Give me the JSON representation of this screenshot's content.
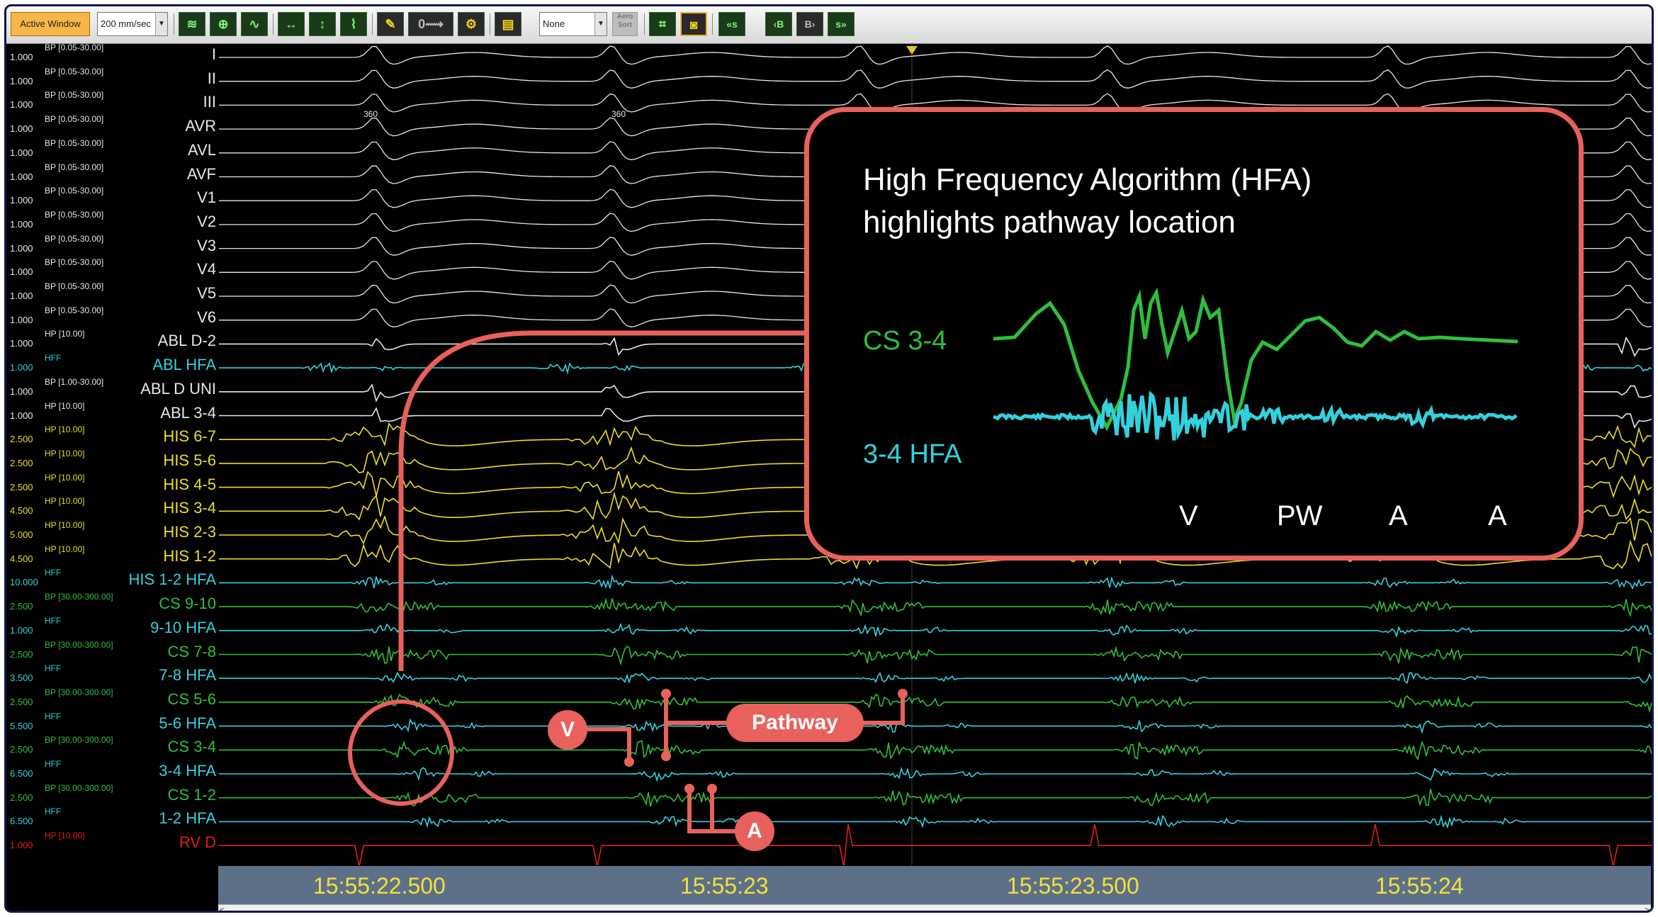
{
  "toolbar": {
    "active_window_label": "Active Window",
    "sweep_speed": "200 mm/sec",
    "reference": "None",
    "aero_label": "Aero Sort",
    "nav_prev_s": "«s",
    "nav_prev_b": "‹B",
    "nav_next_b": "B›",
    "nav_next_s": "s»"
  },
  "colors": {
    "ecg": "#e6e6e6",
    "abl": "#e6e6e6",
    "hfa_cyan": "#33d1de",
    "his_yellow": "#ecdc2a",
    "cs_green": "#2fbf3d",
    "rv_red": "#e0201c",
    "callout": "#e8615c",
    "time_text": "#f2e23a"
  },
  "channels": [
    {
      "gain": "1.000",
      "filter": "BP [0.05-30.00]",
      "name": "I",
      "color": "#e6e6e6"
    },
    {
      "gain": "1.000",
      "filter": "BP [0.05-30.00]",
      "name": "II",
      "color": "#e6e6e6"
    },
    {
      "gain": "1.000",
      "filter": "BP [0.05-30.00]",
      "name": "III",
      "color": "#e6e6e6"
    },
    {
      "gain": "1.000",
      "filter": "BP [0.05-30.00]",
      "name": "AVR",
      "color": "#e6e6e6"
    },
    {
      "gain": "1.000",
      "filter": "BP [0.05-30.00]",
      "name": "AVL",
      "color": "#e6e6e6"
    },
    {
      "gain": "1.000",
      "filter": "BP [0.05-30.00]",
      "name": "AVF",
      "color": "#e6e6e6"
    },
    {
      "gain": "1.000",
      "filter": "BP [0.05-30.00]",
      "name": "V1",
      "color": "#e6e6e6"
    },
    {
      "gain": "1.000",
      "filter": "BP [0.05-30.00]",
      "name": "V2",
      "color": "#e6e6e6"
    },
    {
      "gain": "1.000",
      "filter": "BP [0.05-30.00]",
      "name": "V3",
      "color": "#e6e6e6"
    },
    {
      "gain": "1.000",
      "filter": "BP [0.05-30.00]",
      "name": "V4",
      "color": "#e6e6e6"
    },
    {
      "gain": "1.000",
      "filter": "BP [0.05-30.00]",
      "name": "V5",
      "color": "#e6e6e6"
    },
    {
      "gain": "1.000",
      "filter": "BP [0.05-30.00]",
      "name": "V6",
      "color": "#e6e6e6"
    },
    {
      "gain": "1.000",
      "filter": "HP [10.00]",
      "name": "ABL D-2",
      "color": "#e6e6e6"
    },
    {
      "gain": "1.000",
      "filter": "HFF",
      "name": "ABL HFA",
      "color": "#33d1de"
    },
    {
      "gain": "1.000",
      "filter": "BP [1.00-30.00]",
      "name": "ABL D UNI",
      "color": "#e6e6e6"
    },
    {
      "gain": "1.000",
      "filter": "HP [10.00]",
      "name": "ABL 3-4",
      "color": "#e6e6e6"
    },
    {
      "gain": "2.500",
      "filter": "HP [10.00]",
      "name": "HIS 6-7",
      "color": "#ecdc2a"
    },
    {
      "gain": "2.500",
      "filter": "HP [10.00]",
      "name": "HIS 5-6",
      "color": "#ecdc2a"
    },
    {
      "gain": "2.500",
      "filter": "HP [10.00]",
      "name": "HIS 4-5",
      "color": "#ecdc2a"
    },
    {
      "gain": "4.500",
      "filter": "HP [10.00]",
      "name": "HIS 3-4",
      "color": "#ecdc2a"
    },
    {
      "gain": "5.000",
      "filter": "HP [10.00]",
      "name": "HIS 2-3",
      "color": "#ecdc2a"
    },
    {
      "gain": "4.500",
      "filter": "HP [10.00]",
      "name": "HIS 1-2",
      "color": "#ecdc2a"
    },
    {
      "gain": "10.000",
      "filter": "HFF",
      "name": "HIS 1-2 HFA",
      "color": "#33d1de"
    },
    {
      "gain": "2.500",
      "filter": "BP [30.00-300.00]",
      "name": "CS 9-10",
      "color": "#2fbf3d"
    },
    {
      "gain": "1.000",
      "filter": "HFF",
      "name": "9-10 HFA",
      "color": "#33d1de"
    },
    {
      "gain": "2.500",
      "filter": "BP [30.00-300.00]",
      "name": "CS 7-8",
      "color": "#2fbf3d"
    },
    {
      "gain": "3.500",
      "filter": "HFF",
      "name": "7-8 HFA",
      "color": "#33d1de"
    },
    {
      "gain": "2.500",
      "filter": "BP [30.00-300.00]",
      "name": "CS 5-6",
      "color": "#2fbf3d"
    },
    {
      "gain": "5.500",
      "filter": "HFF",
      "name": "5-6 HFA",
      "color": "#33d1de"
    },
    {
      "gain": "2.500",
      "filter": "BP [30.00-300.00]",
      "name": "CS 3-4",
      "color": "#2fbf3d"
    },
    {
      "gain": "6.500",
      "filter": "HFF",
      "name": "3-4 HFA",
      "color": "#33d1de"
    },
    {
      "gain": "2.500",
      "filter": "BP [30.00-300.00]",
      "name": "CS 1-2",
      "color": "#2fbf3d"
    },
    {
      "gain": "6.500",
      "filter": "HFF",
      "name": "1-2 HFA",
      "color": "#33d1de"
    },
    {
      "gain": "1.000",
      "filter": "HP [10.00]",
      "name": "RV D",
      "color": "#e0201c"
    }
  ],
  "annotations": {
    "qt_1": "360",
    "qt_2": "360"
  },
  "time_axis": [
    "15:55:22.500",
    "15:55:23",
    "15:55:23.500",
    "15:55:24"
  ],
  "callout": {
    "title_line1": "High Frequency Algorithm (HFA)",
    "title_line2": "highlights pathway location",
    "label_cs": "CS 3-4",
    "label_hfa": "3-4 HFA",
    "markers": [
      "V",
      "PW",
      "A",
      "A"
    ]
  },
  "overlay": {
    "v_label": "V",
    "a_label": "A",
    "pathway_label": "Pathway"
  }
}
